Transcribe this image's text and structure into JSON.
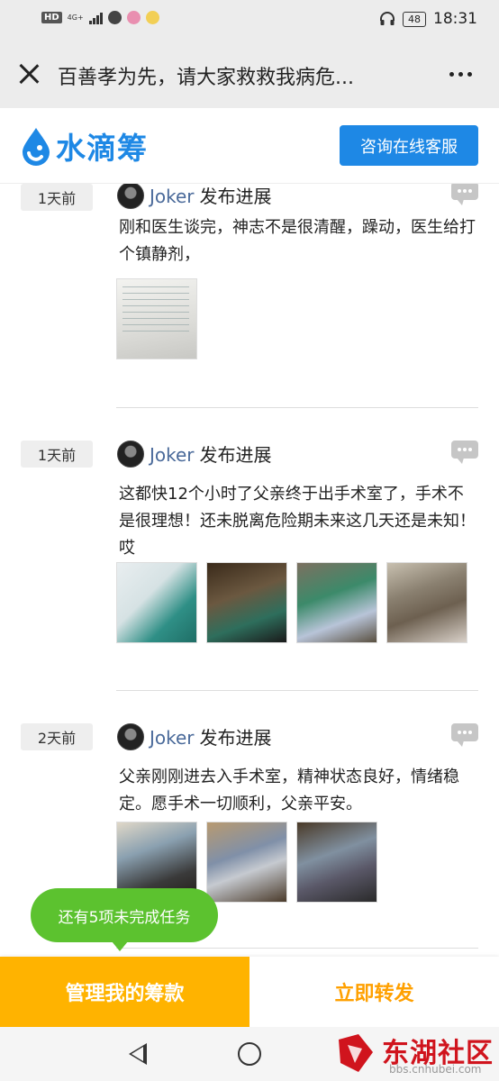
{
  "status_bar": {
    "hd": "HD",
    "network": "4G+",
    "battery": "48",
    "time": "18:31"
  },
  "title_bar": {
    "title": "百善孝为先，请大家救救我病危..."
  },
  "brand": {
    "logo_text": "水滴筹",
    "consult_label": "咨询在线客服",
    "color": "#1e88e5"
  },
  "feed": {
    "entries": [
      {
        "day": "1天前",
        "author": "Joker",
        "action": "发布进展",
        "text": "刚和医生谈完，神志不是很清醒，躁动，医生给打个镇静剂，",
        "photos": [
          "medical-report-photo"
        ]
      },
      {
        "day": "1天前",
        "author": "Joker",
        "action": "发布进展",
        "text": "这都快12个小时了父亲终于出手术室了，手术不是很理想！还未脱离危险期未来这几天还是未知！哎",
        "photos": [
          "operating-room-photo",
          "hospital-bed-photo",
          "ward-photo",
          "ward-doctor-photo"
        ]
      },
      {
        "day": "2天前",
        "author": "Joker",
        "action": "发布进展",
        "text": "父亲刚刚进去入手术室，精神状态良好，情绪稳定。愿手术一切顺利，父亲平安。",
        "photos": [
          "corridor-photo",
          "patient-bed-photo",
          "surgery-entrance-photo"
        ]
      }
    ]
  },
  "task_bubble": {
    "text": "还有5项未完成任务",
    "color": "#5cc22f"
  },
  "action_bar": {
    "manage_label": "管理我的筹款",
    "share_label": "立即转发",
    "accent": "#ffb300"
  },
  "watermark": {
    "title": "东湖社区",
    "url": "bbs.cnhubei.com"
  }
}
